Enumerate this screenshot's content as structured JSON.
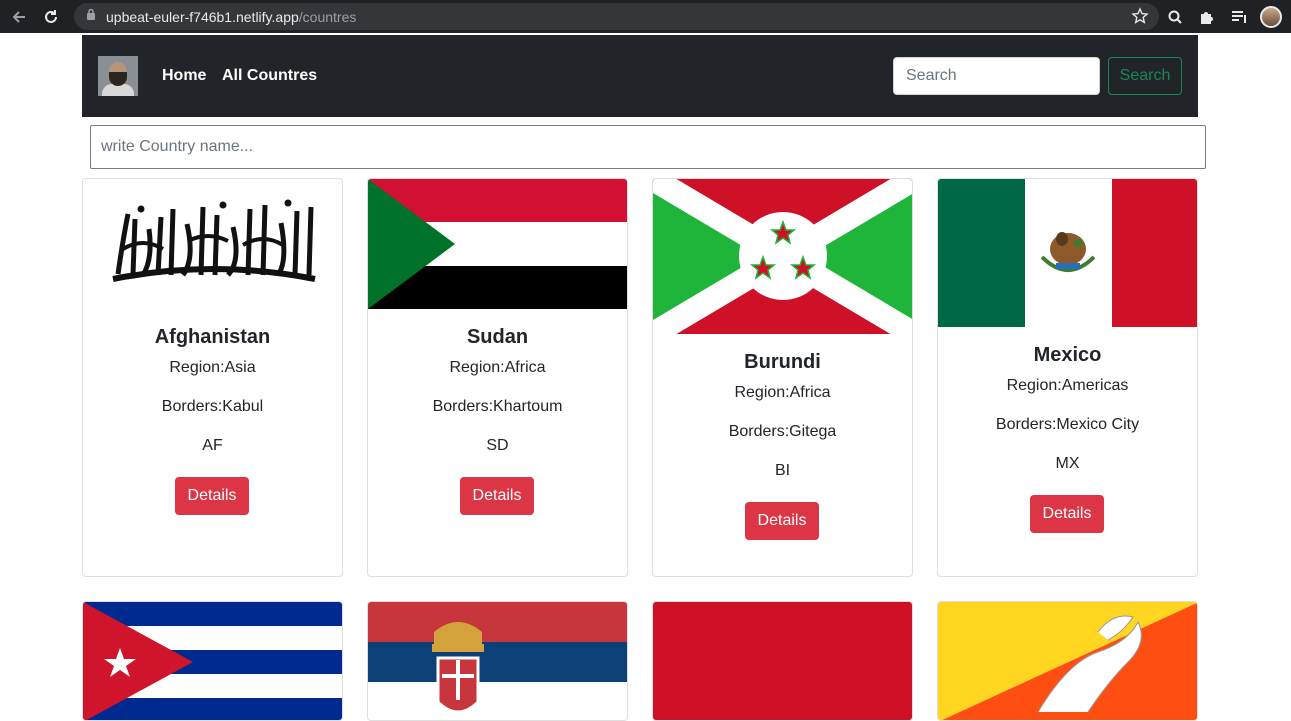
{
  "browser": {
    "url_host": "upbeat-euler-f746b1.netlify.app",
    "url_path": "/countres"
  },
  "navbar": {
    "home_label": "Home",
    "all_countries_label": "All Countres",
    "search_placeholder": "Search",
    "search_button_label": "Search"
  },
  "country_filter": {
    "placeholder": "write Country name..."
  },
  "cards": [
    {
      "name": "Afghanistan",
      "region": "Region:Asia",
      "borders": "Borders:Kabul",
      "code": "AF",
      "button": "Details"
    },
    {
      "name": "Sudan",
      "region": "Region:Africa",
      "borders": "Borders:Khartoum",
      "code": "SD",
      "button": "Details"
    },
    {
      "name": "Burundi",
      "region": "Region:Africa",
      "borders": "Borders:Gitega",
      "code": "BI",
      "button": "Details"
    },
    {
      "name": "Mexico",
      "region": "Region:Americas",
      "borders": "Borders:Mexico City",
      "code": "MX",
      "button": "Details"
    }
  ],
  "colors": {
    "navbar_bg": "#212529",
    "details_button": "#dc3545",
    "search_button": "#198754"
  }
}
